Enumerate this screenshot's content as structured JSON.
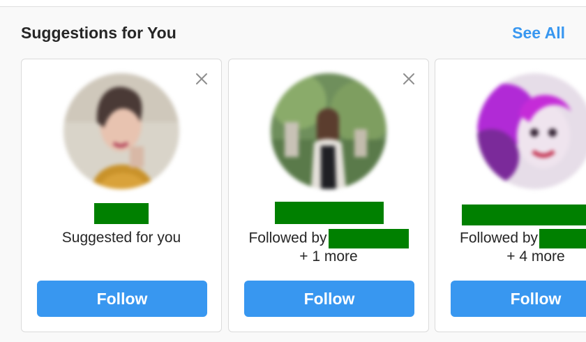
{
  "header": {
    "title": "Suggestions for You",
    "see_all": "See All"
  },
  "cards": [
    {
      "subtitle": "Suggested for you",
      "follow_label": "Follow",
      "dismiss_icon": "close-icon"
    },
    {
      "subtitle_prefix": "Followed by",
      "subtitle_more": "+ 1 more",
      "follow_label": "Follow",
      "dismiss_icon": "close-icon"
    },
    {
      "subtitle_prefix": "Followed by",
      "subtitle_more": "+ 4 more",
      "follow_label": "Follow"
    }
  ],
  "colors": {
    "accent": "#3897f0",
    "redaction": "#008000"
  }
}
